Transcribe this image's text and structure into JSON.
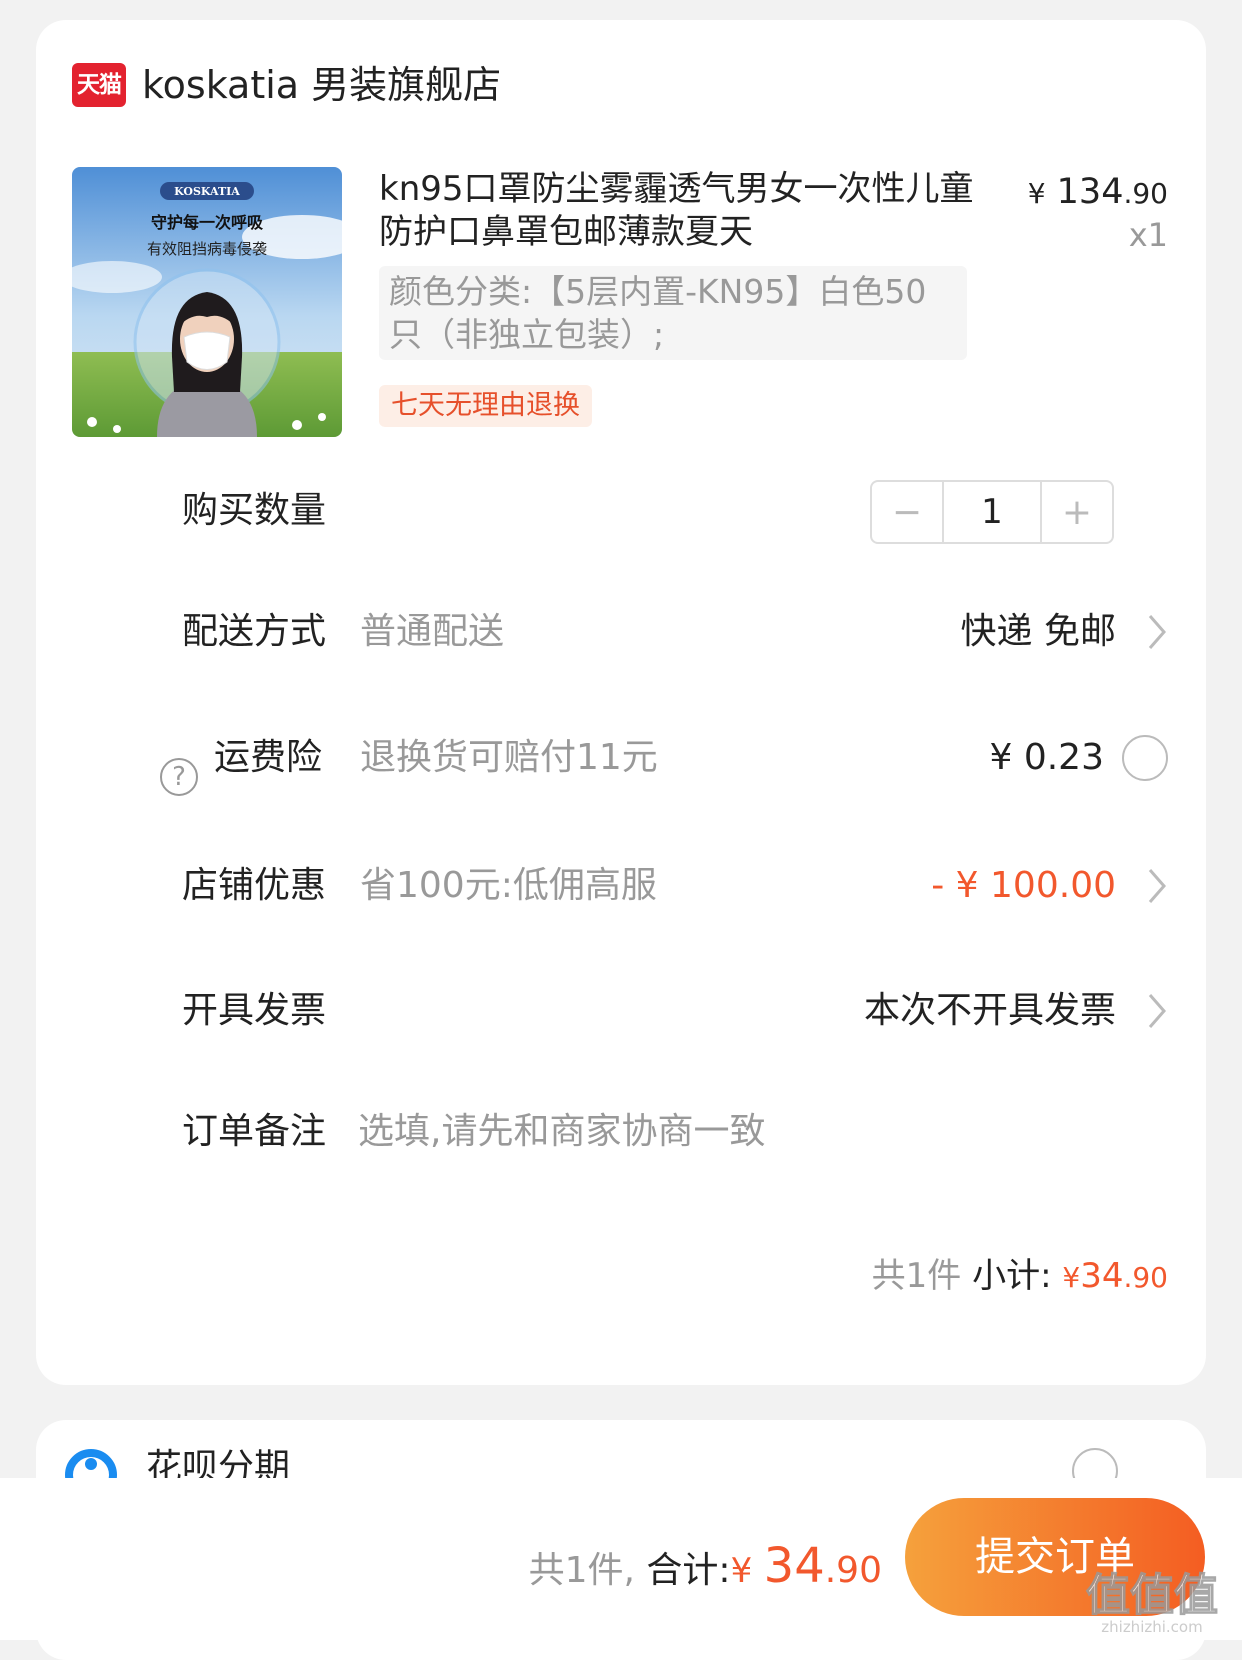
{
  "store": {
    "logo_text": "天猫",
    "name": "koskatia 男装旗舰店"
  },
  "product": {
    "image_brand": "KOSKATIA",
    "image_line1": "守护每一次呼吸",
    "image_line2": "有效阻挡病毒侵袭",
    "title": "kn95口罩防尘雾霾透气男女一次性儿童防护口鼻罩包邮薄款夏天",
    "price_currency": "¥",
    "price_int": "134",
    "price_dec": ".90",
    "quantity_label": "x1",
    "sku": "颜色分类:【5层内置-KN95】白色50只（非独立包装）;",
    "tag": "七天无理由退换"
  },
  "quantity": {
    "label": "购买数量",
    "minus": "−",
    "value": "1",
    "plus": "+"
  },
  "delivery": {
    "label": "配送方式",
    "sub": "普通配送",
    "value": "快递 免邮"
  },
  "insurance": {
    "label": "运费险",
    "help": "?",
    "sub": "退换货可赔付11元",
    "value": "¥ 0.23"
  },
  "discount": {
    "label": "店铺优惠",
    "sub": "省100元:低佣高服",
    "value": "- ¥ 100.00"
  },
  "invoice": {
    "label": "开具发票",
    "value": "本次不开具发票"
  },
  "note": {
    "label": "订单备注",
    "placeholder": "选填,请先和商家协商一致"
  },
  "subtotal": {
    "count_text": "共1件",
    "label": "小计:",
    "currency": "¥",
    "int": "34",
    "dec": ".90"
  },
  "huabei": {
    "label": "花呗分期"
  },
  "bottom": {
    "count_text": "共1件,",
    "label": "合计:",
    "currency": "¥",
    "int": "34",
    "dec": ".90",
    "submit": "提交订单"
  },
  "watermark": {
    "text": "值值值",
    "url": "zhizhizhi.com"
  },
  "colors": {
    "accent": "#f2582d",
    "tmall_red": "#e3222f",
    "muted": "#999999",
    "button_start": "#f5a13c",
    "button_end": "#f45d22"
  }
}
